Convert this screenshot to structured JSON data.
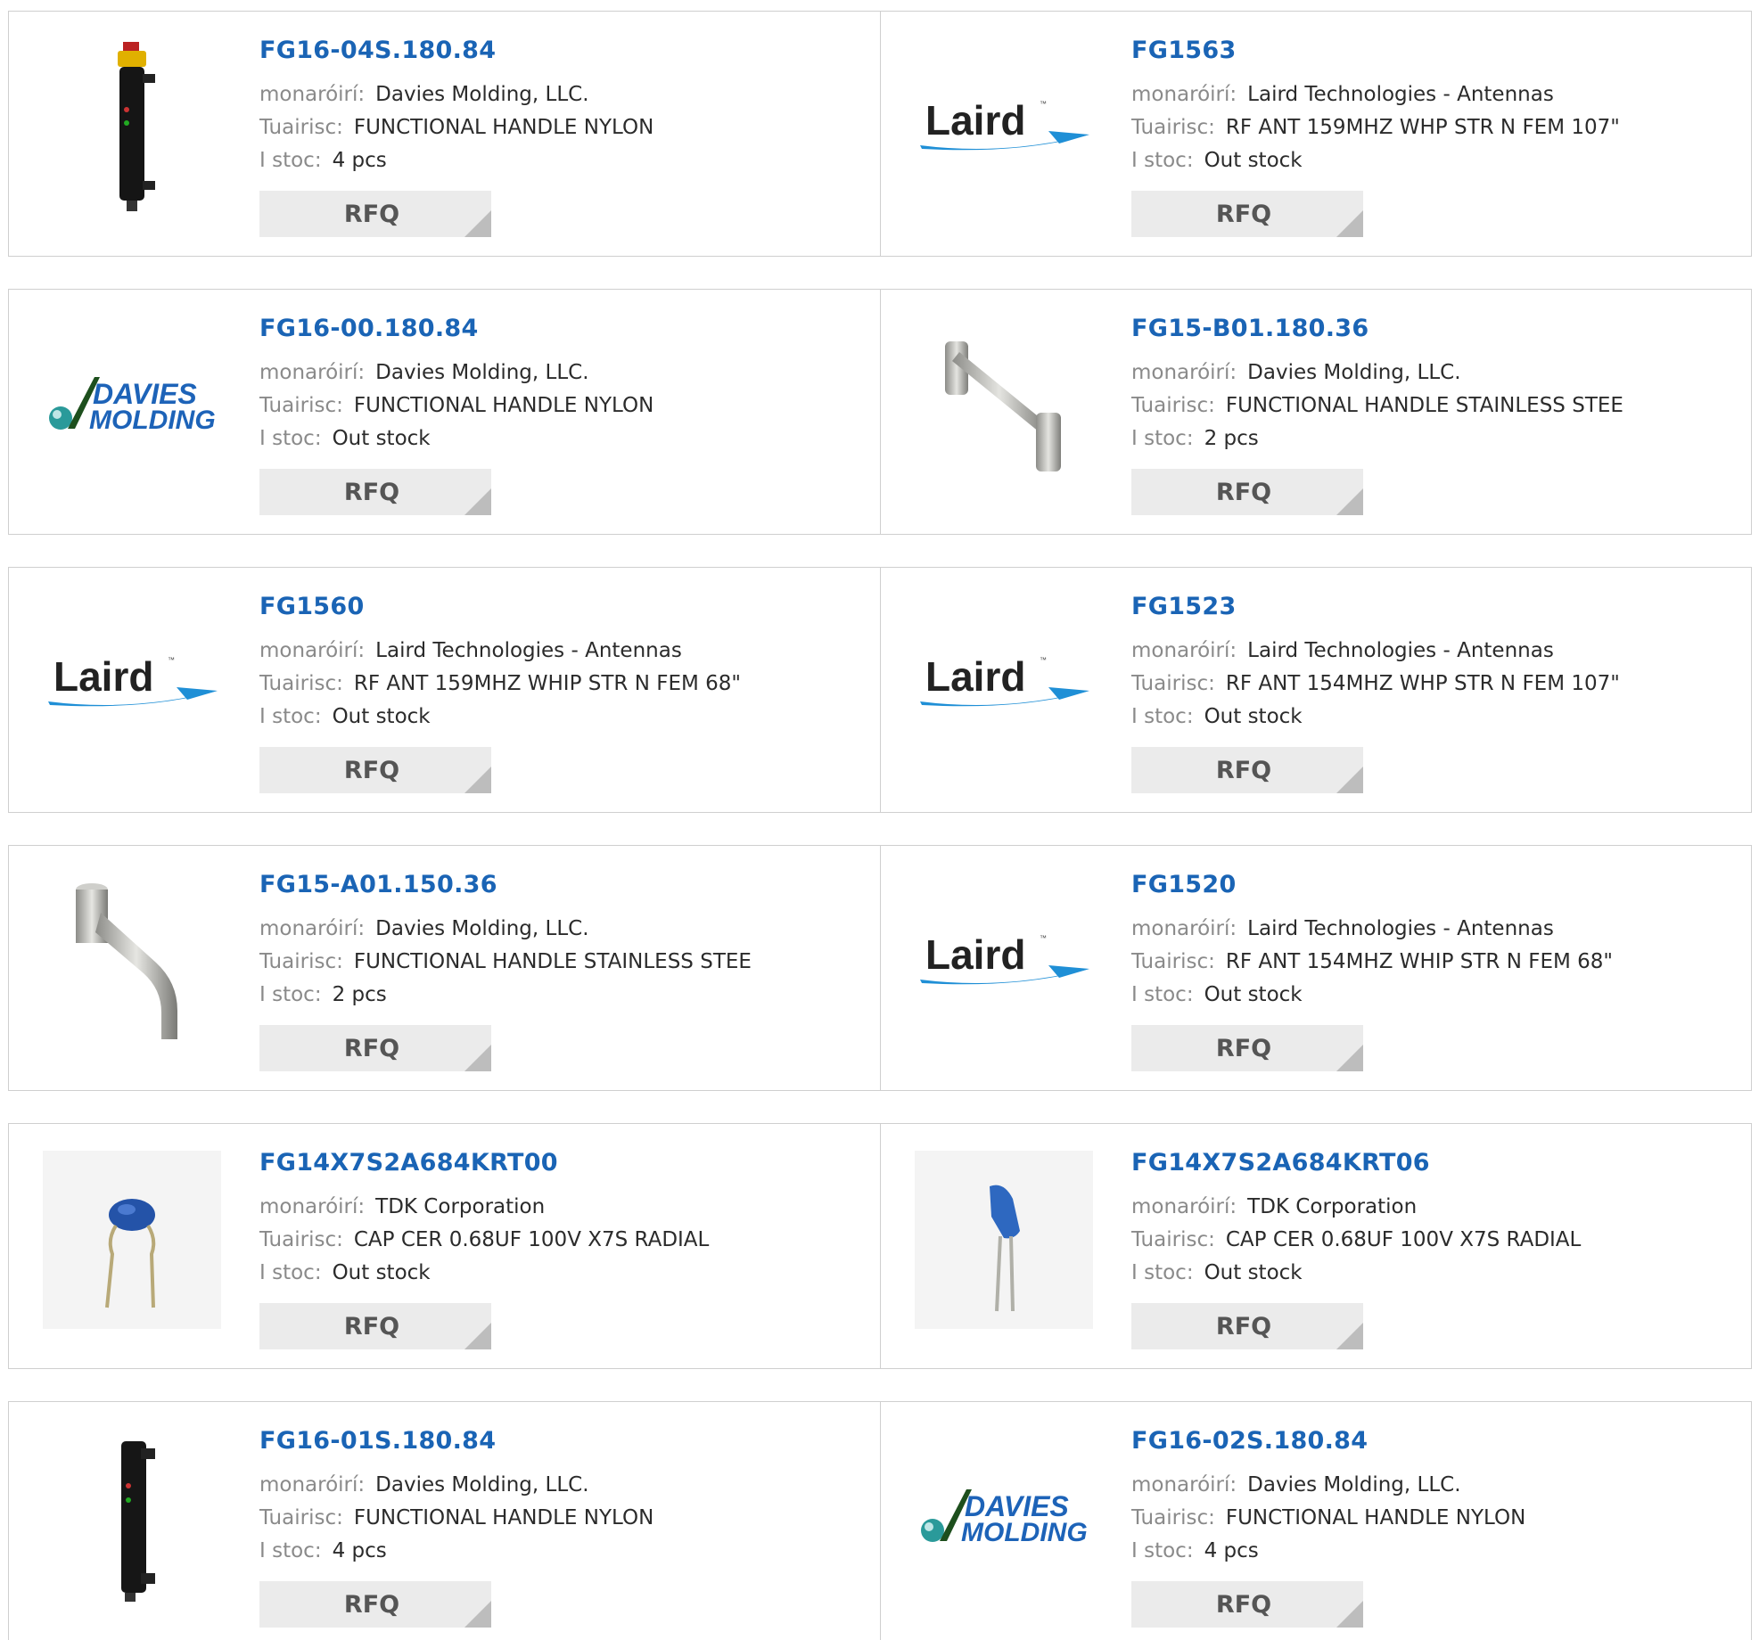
{
  "labels": {
    "manufacturer": "monaróirí:",
    "description": "Tuairisc:",
    "stock": "I stoc:",
    "rfq": "RFQ"
  },
  "colors": {
    "part_link": "#1a64b5",
    "rfq_bg": "#ebebeb",
    "border": "#cfcfcf"
  },
  "rows": [
    {
      "left": {
        "part": "FG16-04S.180.84",
        "manufacturer": "Davies Molding, LLC.",
        "description": "FUNCTIONAL HANDLE NYLON",
        "stock": "4 pcs",
        "image": "nylon-handle-estop-icon"
      },
      "right": {
        "part": "FG1563",
        "manufacturer": "Laird Technologies - Antennas",
        "description": "RF ANT 159MHZ WHP STR N FEM 107\"",
        "stock": "Out stock",
        "image": "laird-logo"
      }
    },
    {
      "left": {
        "part": "FG16-00.180.84",
        "manufacturer": "Davies Molding, LLC.",
        "description": "FUNCTIONAL HANDLE NYLON",
        "stock": "Out stock",
        "image": "davies-molding-logo"
      },
      "right": {
        "part": "FG15-B01.180.36",
        "manufacturer": "Davies Molding, LLC.",
        "description": "FUNCTIONAL HANDLE STAINLESS STEE",
        "stock": "2 pcs",
        "image": "stainless-bar-handle-icon"
      }
    },
    {
      "left": {
        "part": "FG1560",
        "manufacturer": "Laird Technologies - Antennas",
        "description": "RF ANT 159MHZ WHIP STR N FEM 68\"",
        "stock": "Out stock",
        "image": "laird-logo"
      },
      "right": {
        "part": "FG1523",
        "manufacturer": "Laird Technologies - Antennas",
        "description": "RF ANT 154MHZ WHP STR N FEM 107\"",
        "stock": "Out stock",
        "image": "laird-logo"
      }
    },
    {
      "left": {
        "part": "FG15-A01.150.36",
        "manufacturer": "Davies Molding, LLC.",
        "description": "FUNCTIONAL HANDLE STAINLESS STEE",
        "stock": "2 pcs",
        "image": "stainless-bent-handle-icon"
      },
      "right": {
        "part": "FG1520",
        "manufacturer": "Laird Technologies - Antennas",
        "description": "RF ANT 154MHZ WHIP STR N FEM 68\"",
        "stock": "Out stock",
        "image": "laird-logo"
      }
    },
    {
      "left": {
        "part": "FG14X7S2A684KRT00",
        "manufacturer": "TDK Corporation",
        "description": "CAP CER 0.68UF 100V X7S RADIAL",
        "stock": "Out stock",
        "image": "ceramic-capacitor-icon"
      },
      "right": {
        "part": "FG14X7S2A684KRT06",
        "manufacturer": "TDK Corporation",
        "description": "CAP CER 0.68UF 100V X7S RADIAL",
        "stock": "Out stock",
        "image": "ceramic-capacitor-side-icon"
      }
    },
    {
      "left": {
        "part": "FG16-01S.180.84",
        "manufacturer": "Davies Molding, LLC.",
        "description": "FUNCTIONAL HANDLE NYLON",
        "stock": "4 pcs",
        "image": "nylon-handle-icon"
      },
      "right": {
        "part": "FG16-02S.180.84",
        "manufacturer": "Davies Molding, LLC.",
        "description": "FUNCTIONAL HANDLE NYLON",
        "stock": "4 pcs",
        "image": "davies-molding-logo"
      }
    }
  ]
}
